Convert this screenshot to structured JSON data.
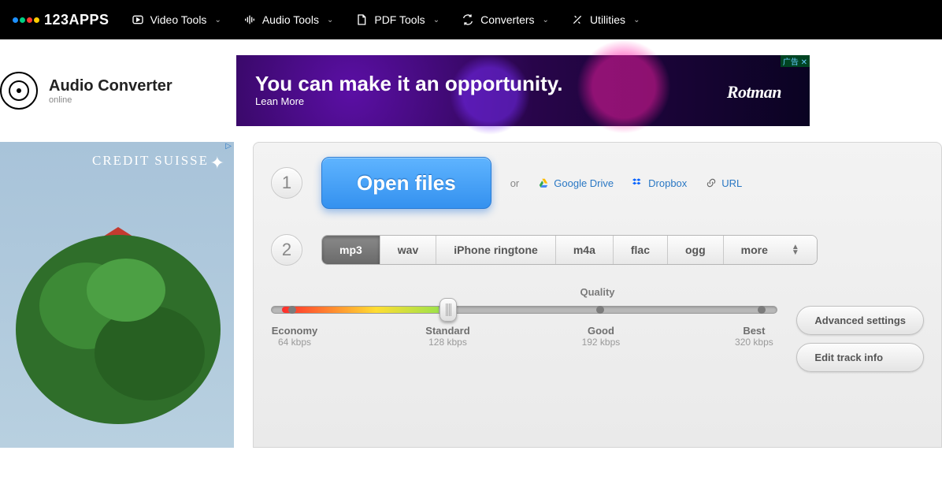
{
  "brand": "123APPS",
  "nav": {
    "video": "Video Tools",
    "audio": "Audio Tools",
    "pdf": "PDF Tools",
    "converters": "Converters",
    "utilities": "Utilities"
  },
  "app": {
    "title": "Audio Converter",
    "subtitle": "online"
  },
  "top_ad": {
    "headline": "You can make it an opportunity.",
    "cta": "Lean More",
    "brand": "Rotman",
    "badge": "广告"
  },
  "side_ad": {
    "brand": "CREDIT SUISSE",
    "badge": "▷"
  },
  "step1": {
    "open": "Open files",
    "or": "or",
    "gdrive": "Google Drive",
    "dropbox": "Dropbox",
    "url": "URL"
  },
  "step2": {
    "formats": {
      "mp3": "mp3",
      "wav": "wav",
      "ringtone": "iPhone ringtone",
      "m4a": "m4a",
      "flac": "flac",
      "ogg": "ogg",
      "more": "more"
    },
    "quality_title": "Quality",
    "scale": {
      "economy": {
        "label": "Economy",
        "value": "64 kbps"
      },
      "standard": {
        "label": "Standard",
        "value": "128 kbps"
      },
      "good": {
        "label": "Good",
        "value": "192 kbps"
      },
      "best": {
        "label": "Best",
        "value": "320 kbps"
      }
    },
    "adv": "Advanced settings",
    "edit": "Edit track info"
  }
}
